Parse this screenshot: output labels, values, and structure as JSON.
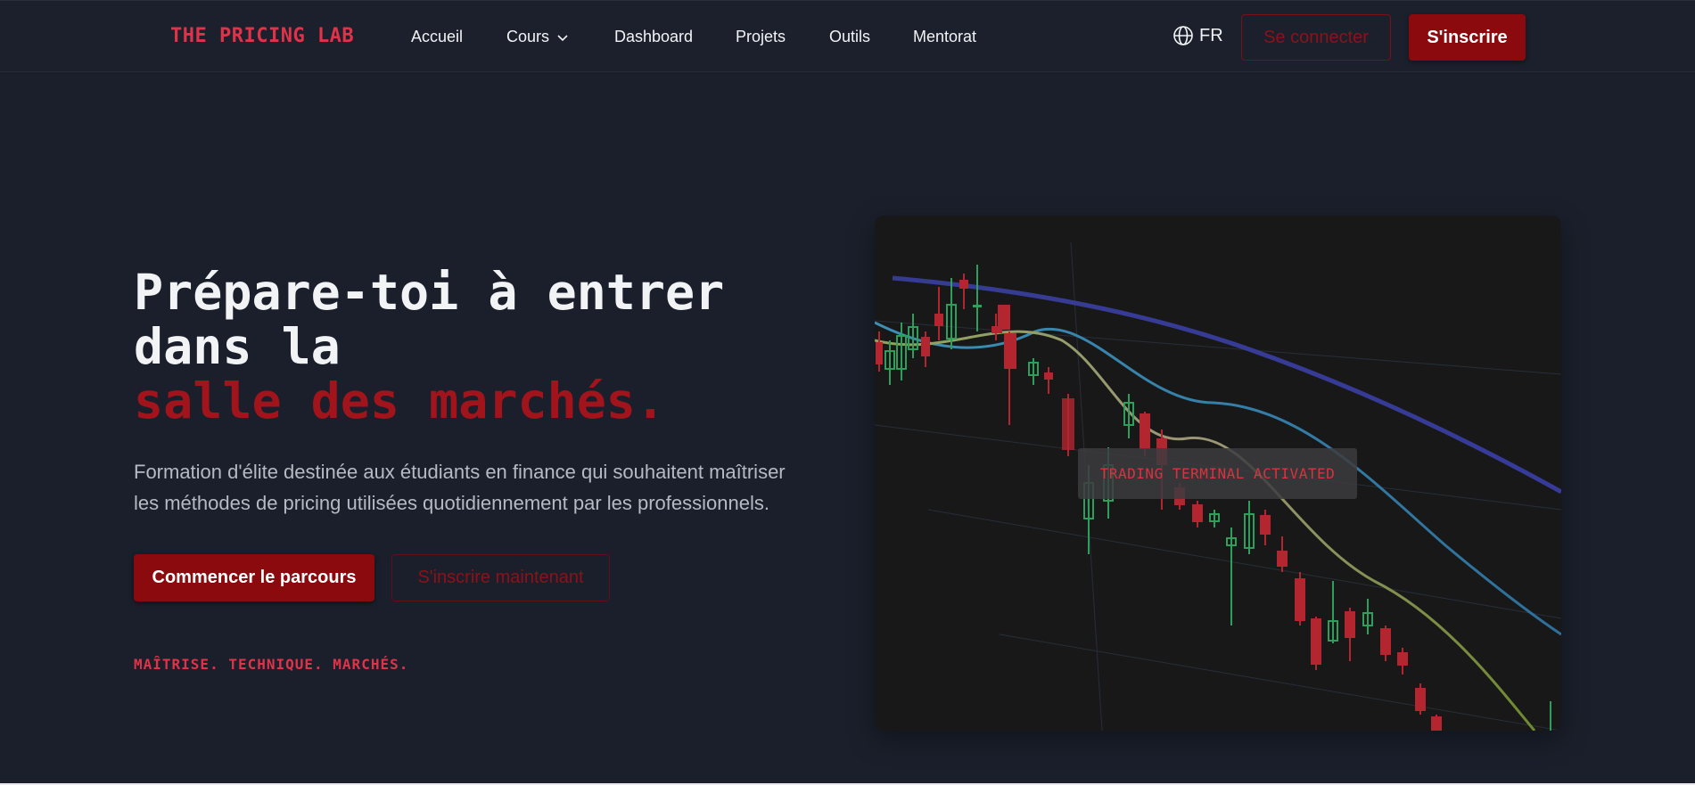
{
  "brand": {
    "logo": "THE PRICING LAB"
  },
  "nav": {
    "items": [
      {
        "label": "Accueil"
      },
      {
        "label": "Cours",
        "has_dropdown": true
      },
      {
        "label": "Dashboard"
      },
      {
        "label": "Projets"
      },
      {
        "label": "Outils"
      },
      {
        "label": "Mentorat"
      }
    ],
    "language": "FR",
    "login_label": "Se connecter",
    "signup_label": "S'inscrire"
  },
  "hero": {
    "title_line1": "Prépare-toi à entrer",
    "title_line2": "dans la",
    "title_accent": "salle des marchés.",
    "description": "Formation d'élite destinée aux étudiants en finance qui souhaitent maîtriser les méthodes de pricing utilisées quotidiennement par les professionnels.",
    "primary_cta": "Commencer le parcours",
    "secondary_cta": "S'inscrire maintenant",
    "tagline": "MAÎTRISE. TECHNIQUE. MARCHÉS."
  },
  "terminal": {
    "badge": "TRADING TERMINAL ACTIVATED"
  },
  "colors": {
    "background": "#1a1f2b",
    "accent_red": "#8b0a0e",
    "brand_red": "#e0334a",
    "bullish": "#2e9e5a",
    "bearish": "#b3252f"
  },
  "icons": {
    "language": "globe-icon",
    "dropdown": "chevron-down-icon"
  }
}
